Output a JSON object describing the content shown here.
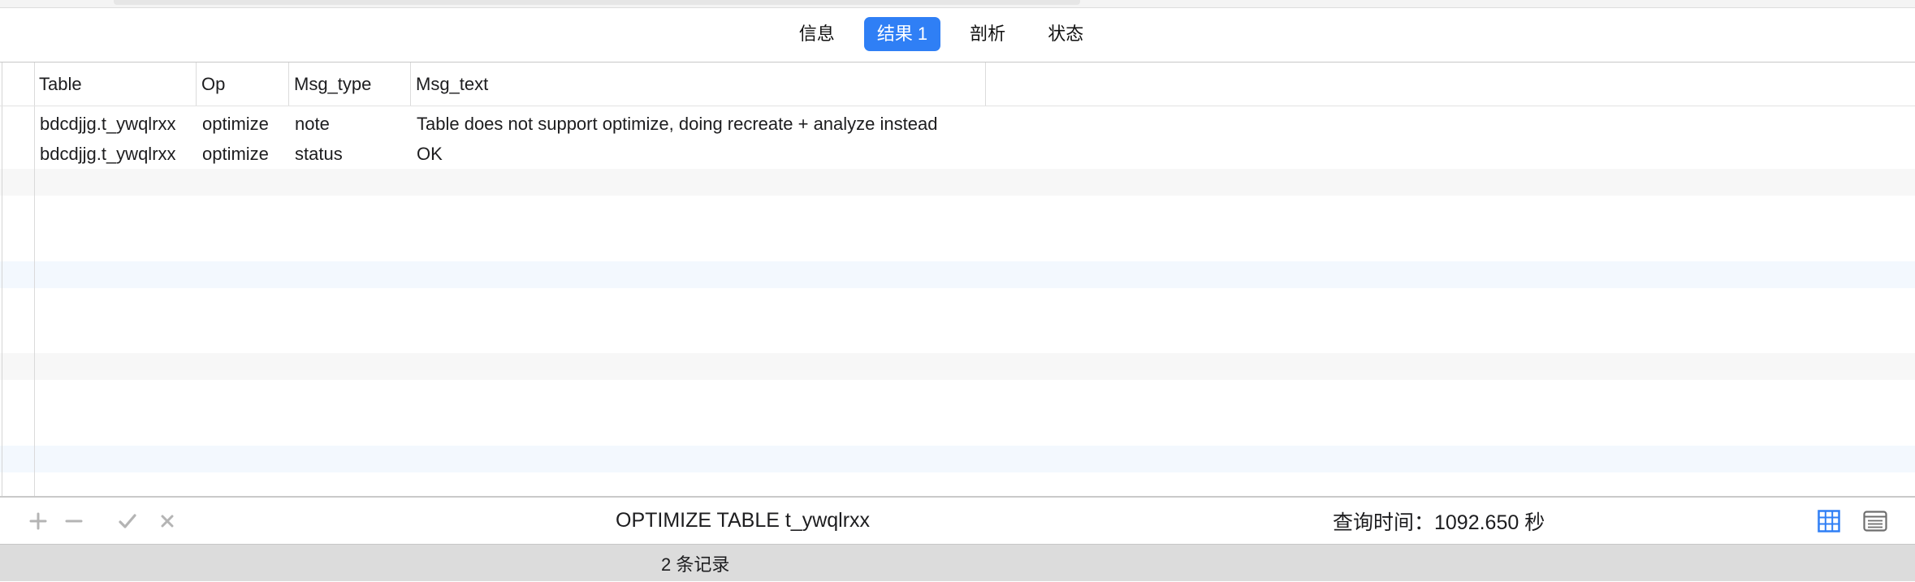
{
  "tabs": [
    {
      "label": "信息",
      "active": false
    },
    {
      "label": "结果 1",
      "active": true
    },
    {
      "label": "剖析",
      "active": false
    },
    {
      "label": "状态",
      "active": false
    }
  ],
  "table": {
    "columns": [
      "Table",
      "Op",
      "Msg_type",
      "Msg_text"
    ],
    "rows": [
      [
        "bdcdjjg.t_ywqlrxx",
        "optimize",
        "note",
        "Table does not support optimize, doing recreate + analyze instead"
      ],
      [
        "bdcdjjg.t_ywqlrxx",
        "optimize",
        "status",
        "OK"
      ]
    ]
  },
  "toolbar": {
    "icons": [
      "add-row-icon",
      "delete-row-icon",
      "apply-icon",
      "discard-icon"
    ],
    "sql": "OPTIMIZE TABLE t_ywqlrxx",
    "query_time": "查询时间：1092.650 秒",
    "view_icons": [
      "grid-view-icon",
      "form-view-icon"
    ]
  },
  "status": {
    "record_count": "2 条记录"
  },
  "colors": {
    "accent": "#2f7ff5",
    "stripe_gray": "#f7f7f7",
    "stripe_blue": "#f3f8fe",
    "status_bar": "#dcdcdc"
  }
}
